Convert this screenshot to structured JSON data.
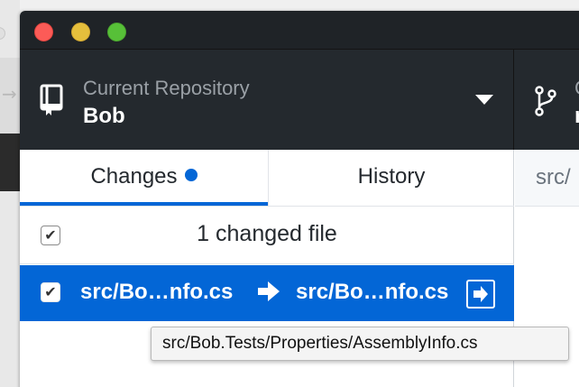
{
  "window": {
    "traffic_lights": [
      "close",
      "minimize",
      "zoom"
    ]
  },
  "toolbar": {
    "repository": {
      "label": "Current Repository",
      "name": "Bob",
      "icon": "repo-icon"
    },
    "branch": {
      "label": "C",
      "name": "r",
      "icon": "git-branch-icon"
    }
  },
  "tabs": [
    {
      "label": "Changes",
      "active": true,
      "has_indicator": true
    },
    {
      "label": "History",
      "active": false
    }
  ],
  "changes": {
    "count_label": "1 changed file",
    "select_all_checked": true,
    "files": [
      {
        "checked": true,
        "old_path": "src/Bo…nfo.cs",
        "new_path": "src/Bo…nfo.cs",
        "status_icon": "renamed-icon",
        "selected": true
      }
    ]
  },
  "diff": {
    "path_prefix": "src/"
  },
  "tooltip": {
    "text": "src/Bob.Tests/Properties/AssemblyInfo.cs"
  },
  "colors": {
    "accent": "#0366d6",
    "toolbar_bg": "#24292e",
    "titlebar_bg": "#1f2327",
    "close": "#fc5b57",
    "minimize": "#e5bf3c",
    "zoom": "#57c038"
  }
}
